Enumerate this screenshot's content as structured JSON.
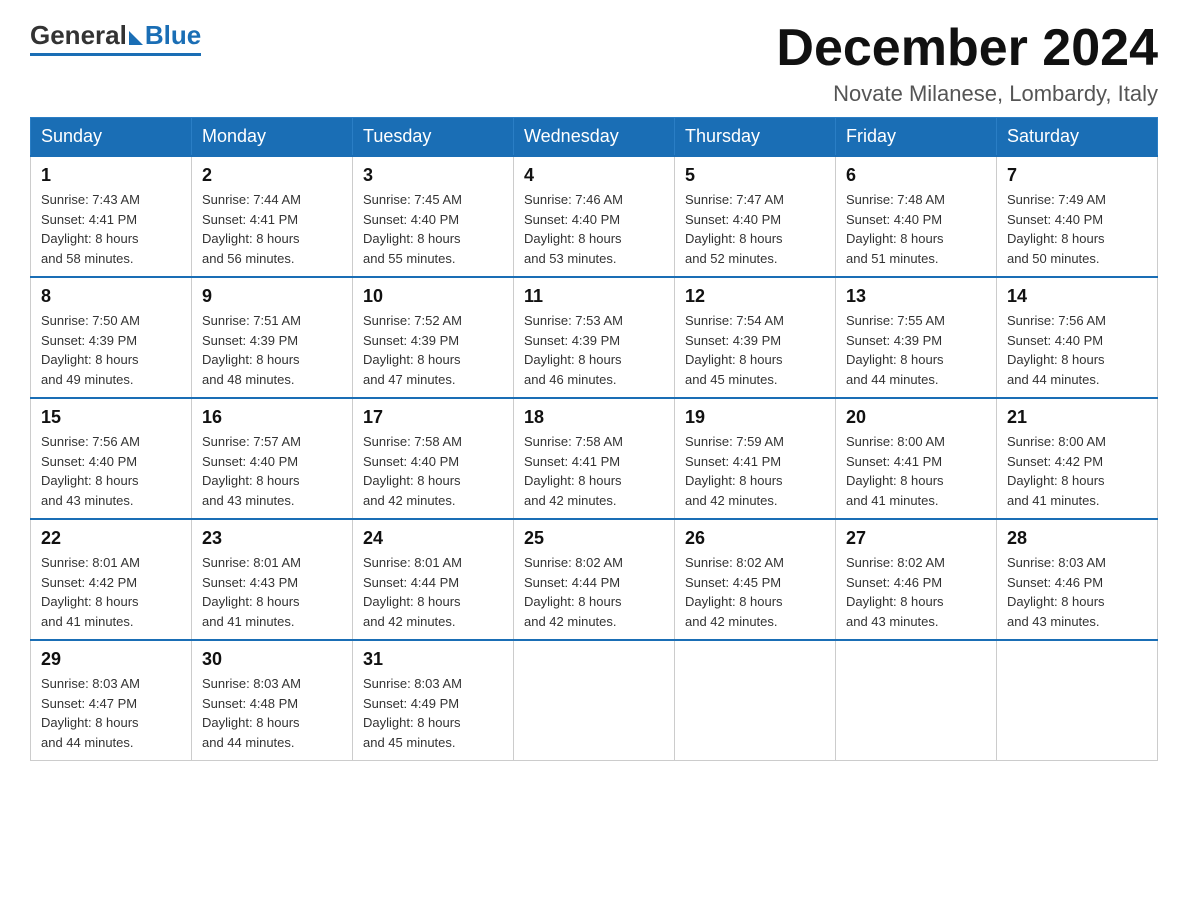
{
  "header": {
    "logo": {
      "general": "General",
      "blue": "Blue"
    },
    "title": "December 2024",
    "location": "Novate Milanese, Lombardy, Italy"
  },
  "days_of_week": [
    "Sunday",
    "Monday",
    "Tuesday",
    "Wednesday",
    "Thursday",
    "Friday",
    "Saturday"
  ],
  "weeks": [
    [
      {
        "day": "1",
        "sunrise": "7:43 AM",
        "sunset": "4:41 PM",
        "daylight_h": "8",
        "daylight_m": "58"
      },
      {
        "day": "2",
        "sunrise": "7:44 AM",
        "sunset": "4:41 PM",
        "daylight_h": "8",
        "daylight_m": "56"
      },
      {
        "day": "3",
        "sunrise": "7:45 AM",
        "sunset": "4:40 PM",
        "daylight_h": "8",
        "daylight_m": "55"
      },
      {
        "day": "4",
        "sunrise": "7:46 AM",
        "sunset": "4:40 PM",
        "daylight_h": "8",
        "daylight_m": "53"
      },
      {
        "day": "5",
        "sunrise": "7:47 AM",
        "sunset": "4:40 PM",
        "daylight_h": "8",
        "daylight_m": "52"
      },
      {
        "day": "6",
        "sunrise": "7:48 AM",
        "sunset": "4:40 PM",
        "daylight_h": "8",
        "daylight_m": "51"
      },
      {
        "day": "7",
        "sunrise": "7:49 AM",
        "sunset": "4:40 PM",
        "daylight_h": "8",
        "daylight_m": "50"
      }
    ],
    [
      {
        "day": "8",
        "sunrise": "7:50 AM",
        "sunset": "4:39 PM",
        "daylight_h": "8",
        "daylight_m": "49"
      },
      {
        "day": "9",
        "sunrise": "7:51 AM",
        "sunset": "4:39 PM",
        "daylight_h": "8",
        "daylight_m": "48"
      },
      {
        "day": "10",
        "sunrise": "7:52 AM",
        "sunset": "4:39 PM",
        "daylight_h": "8",
        "daylight_m": "47"
      },
      {
        "day": "11",
        "sunrise": "7:53 AM",
        "sunset": "4:39 PM",
        "daylight_h": "8",
        "daylight_m": "46"
      },
      {
        "day": "12",
        "sunrise": "7:54 AM",
        "sunset": "4:39 PM",
        "daylight_h": "8",
        "daylight_m": "45"
      },
      {
        "day": "13",
        "sunrise": "7:55 AM",
        "sunset": "4:39 PM",
        "daylight_h": "8",
        "daylight_m": "44"
      },
      {
        "day": "14",
        "sunrise": "7:56 AM",
        "sunset": "4:40 PM",
        "daylight_h": "8",
        "daylight_m": "44"
      }
    ],
    [
      {
        "day": "15",
        "sunrise": "7:56 AM",
        "sunset": "4:40 PM",
        "daylight_h": "8",
        "daylight_m": "43"
      },
      {
        "day": "16",
        "sunrise": "7:57 AM",
        "sunset": "4:40 PM",
        "daylight_h": "8",
        "daylight_m": "43"
      },
      {
        "day": "17",
        "sunrise": "7:58 AM",
        "sunset": "4:40 PM",
        "daylight_h": "8",
        "daylight_m": "42"
      },
      {
        "day": "18",
        "sunrise": "7:58 AM",
        "sunset": "4:41 PM",
        "daylight_h": "8",
        "daylight_m": "42"
      },
      {
        "day": "19",
        "sunrise": "7:59 AM",
        "sunset": "4:41 PM",
        "daylight_h": "8",
        "daylight_m": "42"
      },
      {
        "day": "20",
        "sunrise": "8:00 AM",
        "sunset": "4:41 PM",
        "daylight_h": "8",
        "daylight_m": "41"
      },
      {
        "day": "21",
        "sunrise": "8:00 AM",
        "sunset": "4:42 PM",
        "daylight_h": "8",
        "daylight_m": "41"
      }
    ],
    [
      {
        "day": "22",
        "sunrise": "8:01 AM",
        "sunset": "4:42 PM",
        "daylight_h": "8",
        "daylight_m": "41"
      },
      {
        "day": "23",
        "sunrise": "8:01 AM",
        "sunset": "4:43 PM",
        "daylight_h": "8",
        "daylight_m": "41"
      },
      {
        "day": "24",
        "sunrise": "8:01 AM",
        "sunset": "4:44 PM",
        "daylight_h": "8",
        "daylight_m": "42"
      },
      {
        "day": "25",
        "sunrise": "8:02 AM",
        "sunset": "4:44 PM",
        "daylight_h": "8",
        "daylight_m": "42"
      },
      {
        "day": "26",
        "sunrise": "8:02 AM",
        "sunset": "4:45 PM",
        "daylight_h": "8",
        "daylight_m": "42"
      },
      {
        "day": "27",
        "sunrise": "8:02 AM",
        "sunset": "4:46 PM",
        "daylight_h": "8",
        "daylight_m": "43"
      },
      {
        "day": "28",
        "sunrise": "8:03 AM",
        "sunset": "4:46 PM",
        "daylight_h": "8",
        "daylight_m": "43"
      }
    ],
    [
      {
        "day": "29",
        "sunrise": "8:03 AM",
        "sunset": "4:47 PM",
        "daylight_h": "8",
        "daylight_m": "44"
      },
      {
        "day": "30",
        "sunrise": "8:03 AM",
        "sunset": "4:48 PM",
        "daylight_h": "8",
        "daylight_m": "44"
      },
      {
        "day": "31",
        "sunrise": "8:03 AM",
        "sunset": "4:49 PM",
        "daylight_h": "8",
        "daylight_m": "45"
      },
      null,
      null,
      null,
      null
    ]
  ],
  "labels": {
    "sunrise": "Sunrise:",
    "sunset": "Sunset:",
    "daylight": "Daylight:",
    "hours": "hours",
    "and": "and",
    "minutes": "minutes."
  }
}
